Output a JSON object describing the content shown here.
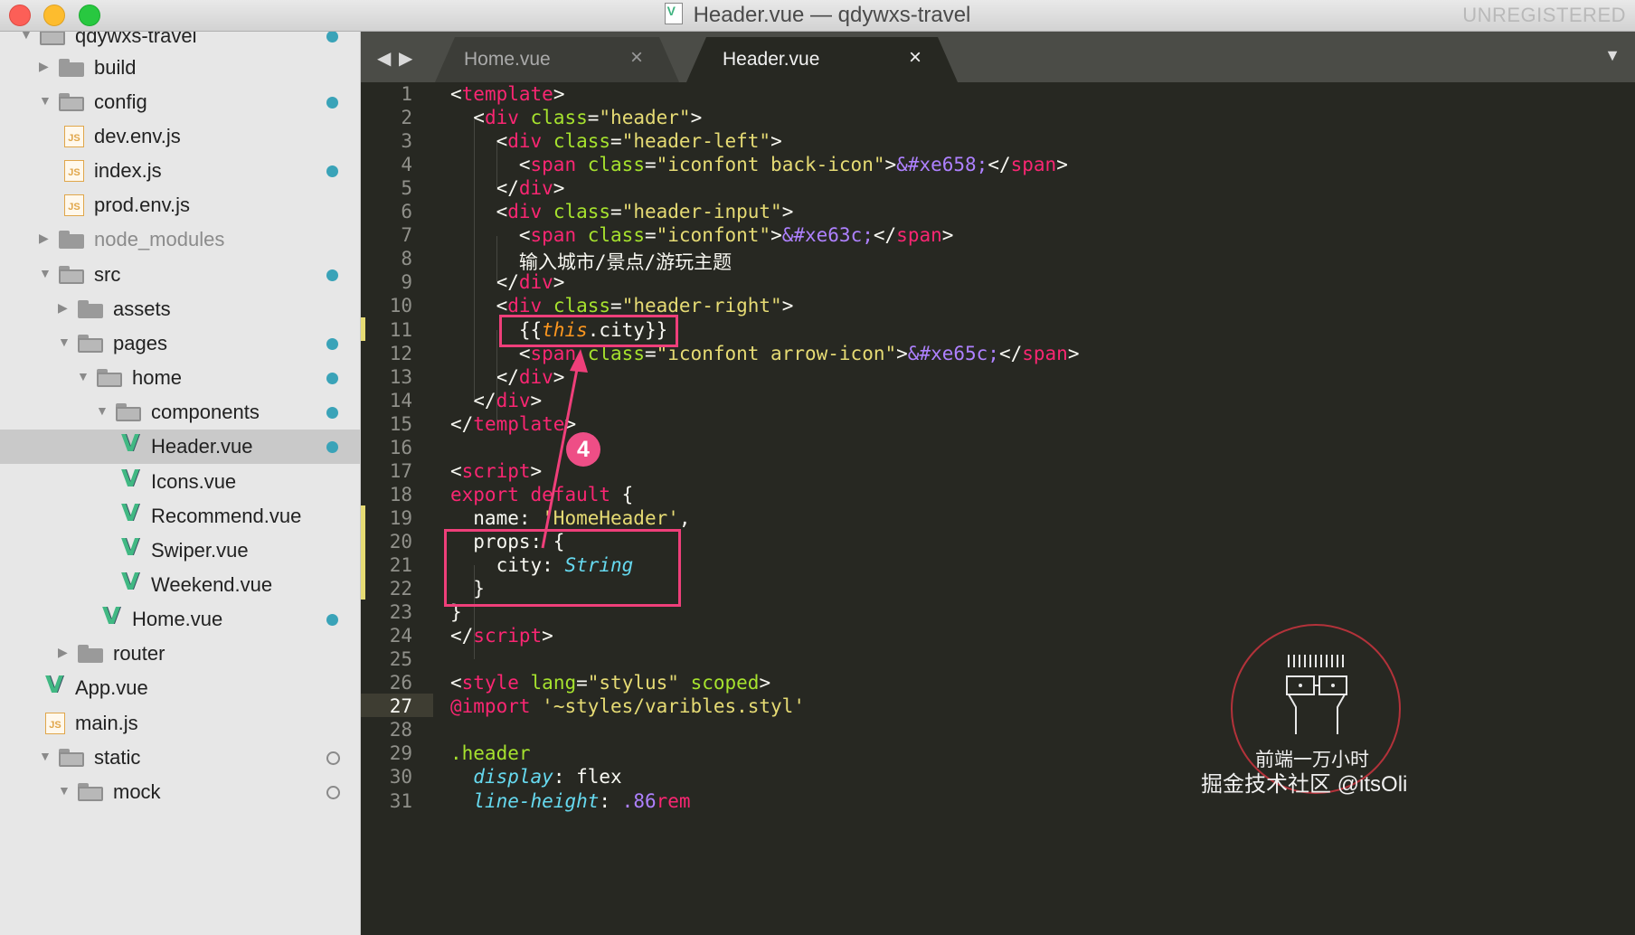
{
  "window": {
    "title": "Header.vue — qdywxs-travel",
    "unregistered": "UNREGISTERED"
  },
  "sidebar": {
    "items": [
      {
        "label": "qdywxs-travel",
        "type": "folder-open",
        "expanded": true,
        "status": "dot"
      },
      {
        "label": "build",
        "type": "folder",
        "expanded": false,
        "status": ""
      },
      {
        "label": "config",
        "type": "folder-open",
        "expanded": true,
        "status": "dot"
      },
      {
        "label": "dev.env.js",
        "type": "js",
        "status": ""
      },
      {
        "label": "index.js",
        "type": "js",
        "status": "dot"
      },
      {
        "label": "prod.env.js",
        "type": "js",
        "status": ""
      },
      {
        "label": "node_modules",
        "type": "folder",
        "expanded": false,
        "status": "",
        "dim": true
      },
      {
        "label": "src",
        "type": "folder-open",
        "expanded": true,
        "status": "dot"
      },
      {
        "label": "assets",
        "type": "folder",
        "expanded": false,
        "status": ""
      },
      {
        "label": "pages",
        "type": "folder-open",
        "expanded": true,
        "status": "dot"
      },
      {
        "label": "home",
        "type": "folder-open",
        "expanded": true,
        "status": "dot"
      },
      {
        "label": "components",
        "type": "folder-open",
        "expanded": true,
        "status": "dot"
      },
      {
        "label": "Header.vue",
        "type": "vue",
        "status": "dot",
        "selected": true
      },
      {
        "label": "Icons.vue",
        "type": "vue",
        "status": ""
      },
      {
        "label": "Recommend.vue",
        "type": "vue",
        "status": ""
      },
      {
        "label": "Swiper.vue",
        "type": "vue",
        "status": ""
      },
      {
        "label": "Weekend.vue",
        "type": "vue",
        "status": ""
      },
      {
        "label": "Home.vue",
        "type": "vue",
        "status": "dot"
      },
      {
        "label": "router",
        "type": "folder",
        "expanded": false,
        "status": ""
      },
      {
        "label": "App.vue",
        "type": "vue",
        "status": ""
      },
      {
        "label": "main.js",
        "type": "js",
        "status": ""
      },
      {
        "label": "static",
        "type": "folder-open",
        "expanded": true,
        "status": "ring"
      },
      {
        "label": "mock",
        "type": "folder-open",
        "expanded": true,
        "status": "ring"
      }
    ]
  },
  "tabs": [
    {
      "label": "Home.vue",
      "active": false,
      "close": "×"
    },
    {
      "label": "Header.vue",
      "active": true,
      "close": "×"
    }
  ],
  "editor": {
    "current_line": 27,
    "lines": [
      [
        [
          "tx",
          "<"
        ],
        [
          "tg",
          "template"
        ],
        [
          "tx",
          ">"
        ]
      ],
      [
        [
          "tx",
          "  <"
        ],
        [
          "tg",
          "div"
        ],
        [
          "tx",
          " "
        ],
        [
          "at",
          "class"
        ],
        [
          "tx",
          "="
        ],
        [
          "st",
          "\"header\""
        ],
        [
          "tx",
          ">"
        ]
      ],
      [
        [
          "tx",
          "    <"
        ],
        [
          "tg",
          "div"
        ],
        [
          "tx",
          " "
        ],
        [
          "at",
          "class"
        ],
        [
          "tx",
          "="
        ],
        [
          "st",
          "\"header-left\""
        ],
        [
          "tx",
          ">"
        ]
      ],
      [
        [
          "tx",
          "      <"
        ],
        [
          "tg",
          "span"
        ],
        [
          "tx",
          " "
        ],
        [
          "at",
          "class"
        ],
        [
          "tx",
          "="
        ],
        [
          "st",
          "\"iconfont back-icon\""
        ],
        [
          "tx",
          ">"
        ],
        [
          "en",
          "&#xe658;"
        ],
        [
          "tx",
          "</"
        ],
        [
          "tg",
          "span"
        ],
        [
          "tx",
          ">"
        ]
      ],
      [
        [
          "tx",
          "    </"
        ],
        [
          "tg",
          "div"
        ],
        [
          "tx",
          ">"
        ]
      ],
      [
        [
          "tx",
          "    <"
        ],
        [
          "tg",
          "div"
        ],
        [
          "tx",
          " "
        ],
        [
          "at",
          "class"
        ],
        [
          "tx",
          "="
        ],
        [
          "st",
          "\"header-input\""
        ],
        [
          "tx",
          ">"
        ]
      ],
      [
        [
          "tx",
          "      <"
        ],
        [
          "tg",
          "span"
        ],
        [
          "tx",
          " "
        ],
        [
          "at",
          "class"
        ],
        [
          "tx",
          "="
        ],
        [
          "st",
          "\"iconfont\""
        ],
        [
          "tx",
          ">"
        ],
        [
          "en",
          "&#xe63c;"
        ],
        [
          "tx",
          "</"
        ],
        [
          "tg",
          "span"
        ],
        [
          "tx",
          ">"
        ]
      ],
      [
        [
          "tx",
          "      输入城市/景点/游玩主题"
        ]
      ],
      [
        [
          "tx",
          "    </"
        ],
        [
          "tg",
          "div"
        ],
        [
          "tx",
          ">"
        ]
      ],
      [
        [
          "tx",
          "    <"
        ],
        [
          "tg",
          "div"
        ],
        [
          "tx",
          " "
        ],
        [
          "at",
          "class"
        ],
        [
          "tx",
          "="
        ],
        [
          "st",
          "\"header-right\""
        ],
        [
          "tx",
          ">"
        ]
      ],
      [
        [
          "tx",
          "      {{"
        ],
        [
          "th",
          "this"
        ],
        [
          "tx",
          ".city}}"
        ]
      ],
      [
        [
          "tx",
          "      <"
        ],
        [
          "tg",
          "span"
        ],
        [
          "tx",
          " "
        ],
        [
          "at",
          "class"
        ],
        [
          "tx",
          "="
        ],
        [
          "st",
          "\"iconfont arrow-icon\""
        ],
        [
          "tx",
          ">"
        ],
        [
          "en",
          "&#xe65c;"
        ],
        [
          "tx",
          "</"
        ],
        [
          "tg",
          "span"
        ],
        [
          "tx",
          ">"
        ]
      ],
      [
        [
          "tx",
          "    </"
        ],
        [
          "tg",
          "div"
        ],
        [
          "tx",
          ">"
        ]
      ],
      [
        [
          "tx",
          "  </"
        ],
        [
          "tg",
          "div"
        ],
        [
          "tx",
          ">"
        ]
      ],
      [
        [
          "tx",
          "</"
        ],
        [
          "tg",
          "template"
        ],
        [
          "tx",
          ">"
        ]
      ],
      [],
      [
        [
          "tx",
          "<"
        ],
        [
          "tg",
          "script"
        ],
        [
          "tx",
          ">"
        ]
      ],
      [
        [
          "kw",
          "export"
        ],
        [
          "tx",
          " "
        ],
        [
          "kw",
          "default"
        ],
        [
          "tx",
          " {"
        ]
      ],
      [
        [
          "tx",
          "  name: "
        ],
        [
          "st",
          "'HomeHeader'"
        ],
        [
          "tx",
          ","
        ]
      ],
      [
        [
          "tx",
          "  props: {"
        ]
      ],
      [
        [
          "tx",
          "    city: "
        ],
        [
          "ty",
          "String"
        ]
      ],
      [
        [
          "tx",
          "  }"
        ]
      ],
      [
        [
          "tx",
          "}"
        ]
      ],
      [
        [
          "tx",
          "</"
        ],
        [
          "tg",
          "script"
        ],
        [
          "tx",
          ">"
        ]
      ],
      [],
      [
        [
          "tx",
          "<"
        ],
        [
          "tg",
          "style"
        ],
        [
          "tx",
          " "
        ],
        [
          "at",
          "lang"
        ],
        [
          "tx",
          "="
        ],
        [
          "st",
          "\"stylus\""
        ],
        [
          "tx",
          " "
        ],
        [
          "at",
          "scoped"
        ],
        [
          "tx",
          ">"
        ]
      ],
      [
        [
          "kw",
          "@import"
        ],
        [
          "tx",
          " "
        ],
        [
          "st",
          "'~styles/varibles.styl'"
        ]
      ],
      [],
      [
        [
          "cl",
          ".header"
        ]
      ],
      [
        [
          "tx",
          "  "
        ],
        [
          "pr",
          "display"
        ],
        [
          "tx",
          ": flex"
        ]
      ],
      [
        [
          "tx",
          "  "
        ],
        [
          "pr",
          "line-height"
        ],
        [
          "tx",
          ": "
        ],
        [
          "en",
          ".86"
        ],
        [
          "kw",
          "rem"
        ]
      ]
    ]
  },
  "annotation": {
    "step_number": "4"
  },
  "watermark": {
    "line1": "前端一万小时",
    "line2": "掘金技术社区 @itsOli"
  },
  "colors": {
    "tag": "#f92672",
    "attribute": "#a6e22e",
    "string": "#e6db74",
    "entity": "#ae81ff",
    "annotation": "#ef3f7a",
    "folder_status_dot": "#3aa3b8"
  }
}
